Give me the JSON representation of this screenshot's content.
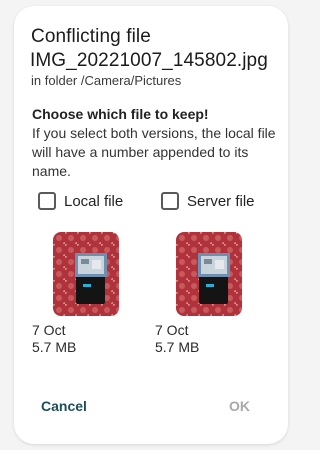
{
  "dialog": {
    "title_line1": "Conflicting file",
    "filename": "IMG_20221007_145802.jpg",
    "folder_text": "in folder /Camera/Pictures",
    "heading": "Choose which file to keep!",
    "description": "If you select both versions, the local file will have a number appended to its name."
  },
  "local": {
    "label": "Local file",
    "checked": false,
    "date": "7 Oct",
    "size": "5.7 MB"
  },
  "server": {
    "label": "Server file",
    "checked": false,
    "date": "7 Oct",
    "size": "5.7 MB"
  },
  "actions": {
    "cancel_label": "Cancel",
    "ok_label": "OK"
  },
  "colors": {
    "accent": "#1e4e5a",
    "disabled": "#a8a8a8",
    "thumbnail_background": "#b0323c"
  }
}
